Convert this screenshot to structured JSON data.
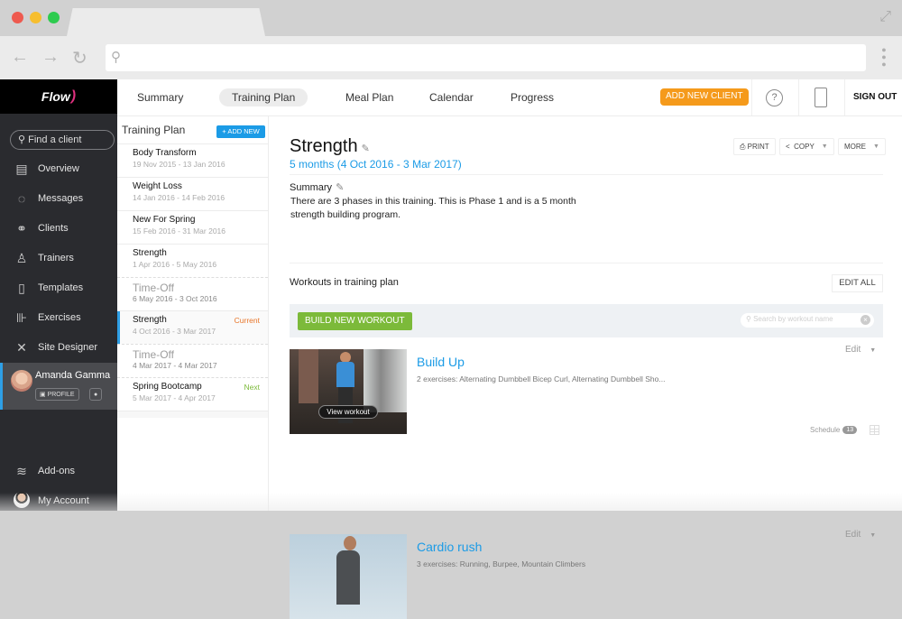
{
  "browser": {
    "traffic_lights": {
      "close": "#ee5a4f",
      "minimize": "#f6be2f",
      "maximize": "#2ecb4f"
    },
    "nav_icons": [
      "back-arrow",
      "forward-arrow",
      "reload"
    ],
    "url_placeholder": ""
  },
  "sidebar": {
    "logo": "Flow",
    "search_placeholder": "Find a client",
    "items": [
      {
        "label": "Overview",
        "icon": "overview-icon",
        "glyph": "▤"
      },
      {
        "label": "Messages",
        "icon": "messages-icon",
        "glyph": "💬"
      },
      {
        "label": "Clients",
        "icon": "clients-icon",
        "glyph": "⚭"
      },
      {
        "label": "Trainers",
        "icon": "trainers-icon",
        "glyph": "♙"
      },
      {
        "label": "Templates",
        "icon": "templates-icon",
        "glyph": "▯"
      },
      {
        "label": "Exercises",
        "icon": "exercises-icon",
        "glyph": "⚖"
      },
      {
        "label": "Site Designer",
        "icon": "site-designer-icon",
        "glyph": "✕"
      }
    ],
    "profile": {
      "name": "Amanda Gamma",
      "profile_label": "PROFILE"
    },
    "bottom": [
      {
        "label": "Add-ons",
        "icon": "addons-icon",
        "glyph": "≋"
      },
      {
        "label": "My Account",
        "icon": "account-avatar"
      }
    ]
  },
  "topnav": {
    "tabs": [
      "Summary",
      "Training Plan",
      "Meal Plan",
      "Calendar",
      "Progress"
    ],
    "active_tab": "Training Plan",
    "add_client": "ADD NEW CLIENT",
    "help": "?",
    "sign_out": "SIGN OUT",
    "accent": "#f59a1b"
  },
  "plans": {
    "title": "Training Plan",
    "add_new": "+ ADD NEW",
    "items": [
      {
        "name": "Body Transform",
        "dates": "19 Nov 2015 - 13 Jan 2016",
        "type": "plan"
      },
      {
        "name": "Weight Loss",
        "dates": "14 Jan 2016 - 14 Feb 2016",
        "type": "plan"
      },
      {
        "name": "New For Spring",
        "dates": "15 Feb 2016 - 31 Mar 2016",
        "type": "plan"
      },
      {
        "name": "Strength",
        "dates": "1 Apr 2016 - 5 May 2016",
        "type": "plan"
      },
      {
        "name": "Time-Off",
        "dates": "6 May 2016 - 3 Oct 2016",
        "type": "off"
      },
      {
        "name": "Strength",
        "dates": "4 Oct 2016 - 3 Mar 2017",
        "type": "plan",
        "badge": "Current",
        "badge_color": "#e8762a",
        "selected": true
      },
      {
        "name": "Time-Off",
        "dates": "4 Mar 2017 - 4 Mar 2017",
        "type": "off"
      },
      {
        "name": "Spring Bootcamp",
        "dates": "5 Mar 2017 - 4 Apr 2017",
        "type": "plan",
        "badge": "Next",
        "badge_color": "#7cba3a"
      }
    ]
  },
  "detail": {
    "title": "Strength",
    "duration": "5 months (4 Oct 2016 - 3 Mar 2017)",
    "actions": {
      "print": "PRINT",
      "copy": "COPY",
      "more": "MORE"
    },
    "summary_label": "Summary",
    "summary_text": "There are 3 phases in this training. This is Phase 1 and is a 5 month strength building program.",
    "workouts_label": "Workouts in training plan",
    "edit_all": "EDIT ALL",
    "build_new": "BUILD NEW WORKOUT",
    "search_placeholder": "Search by workout name",
    "workouts": [
      {
        "name": "Build Up",
        "desc": "2 exercises: Alternating Dumbbell Bicep Curl, Alternating Dumbbell Sho...",
        "view_label": "View workout",
        "edit": "Edit",
        "schedule_label": "Schedule",
        "schedule_count": "13"
      },
      {
        "name": "Cardio rush",
        "desc": "3 exercises: Running, Burpee, Mountain Climbers",
        "edit": "Edit"
      }
    ]
  }
}
